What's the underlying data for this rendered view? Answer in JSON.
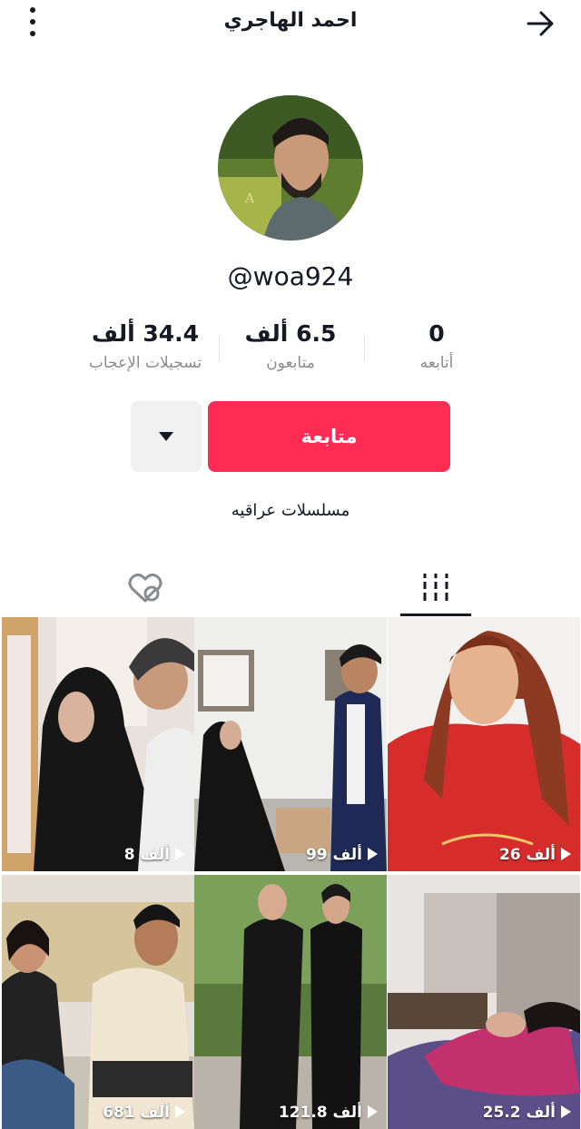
{
  "header": {
    "title": "احمد الهاجري"
  },
  "profile": {
    "handle": "@woa924",
    "bio": "مسلسلات عراقيه"
  },
  "stats": [
    {
      "key": "likes",
      "value": "34.4 ألف",
      "label": "تسجيلات الإعجاب"
    },
    {
      "key": "followers",
      "value": "6.5 ألف",
      "label": "متابعون"
    },
    {
      "key": "following",
      "value": "0",
      "label": "أتابعه"
    }
  ],
  "actions": {
    "follow_label": "متابعة"
  },
  "tabs": [
    {
      "key": "liked",
      "icon": "heart-hidden-icon",
      "active": false
    },
    {
      "key": "videos",
      "icon": "grid-icon",
      "active": true
    }
  ],
  "videos": [
    {
      "views": "8 ألف",
      "icon": "play-icon"
    },
    {
      "views": "99 ألف",
      "icon": "play-icon"
    },
    {
      "views": "26 ألف",
      "icon": "play-icon"
    },
    {
      "views": "681 ألف",
      "icon": "play-icon"
    },
    {
      "views": "121.8 ألف",
      "icon": "play-icon"
    },
    {
      "views": "25.2 ألف",
      "icon": "play-icon"
    }
  ],
  "colors": {
    "accent": "#fe2c55",
    "text": "#161823",
    "muted": "#8a8b91"
  }
}
